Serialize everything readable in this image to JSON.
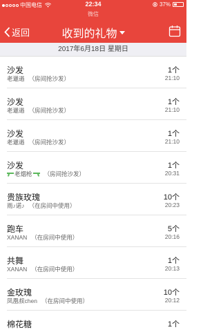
{
  "status_bar": {
    "carrier": "中国电信",
    "time": "22:34",
    "battery": "37%",
    "battery_level": 0.37
  },
  "app_subtitle": "微信",
  "nav": {
    "back_label": "返回",
    "title": "收到的礼物"
  },
  "date_header": "2017年6月18日 星期日",
  "gifts": [
    {
      "name": "沙发",
      "sender": "老邋遢",
      "method": "（房间抢沙发）",
      "qty": "1个",
      "time": "21:10"
    },
    {
      "name": "沙发",
      "sender": "老邋遢",
      "method": "（房间抢沙发）",
      "qty": "1个",
      "time": "21:10"
    },
    {
      "name": "沙发",
      "sender": "老邋遢",
      "method": "（房间抢沙发）",
      "qty": "1个",
      "time": "21:10"
    },
    {
      "name": "沙发",
      "sender": "老烟枪",
      "method": "（房间抢沙发）",
      "qty": "1个",
      "time": "20:31"
    },
    {
      "name": "贵族玫瑰",
      "sender": "雨♪诺♪",
      "method": "（在房间中使用）",
      "qty": "10个",
      "time": "20:23"
    },
    {
      "name": "跑车",
      "sender": "XANAN",
      "method": "（在房间中使用）",
      "qty": "5个",
      "time": "20:16"
    },
    {
      "name": "共舞",
      "sender": "XANAN",
      "method": "（在房间中使用）",
      "qty": "1个",
      "time": "20:13"
    },
    {
      "name": "金玫瑰",
      "sender": "凤凰叔chen",
      "method": "（在房间中使用）",
      "qty": "10个",
      "time": "20:12"
    },
    {
      "name": "棉花糖",
      "sender": "",
      "method": "",
      "qty": "1个",
      "time": ""
    }
  ]
}
